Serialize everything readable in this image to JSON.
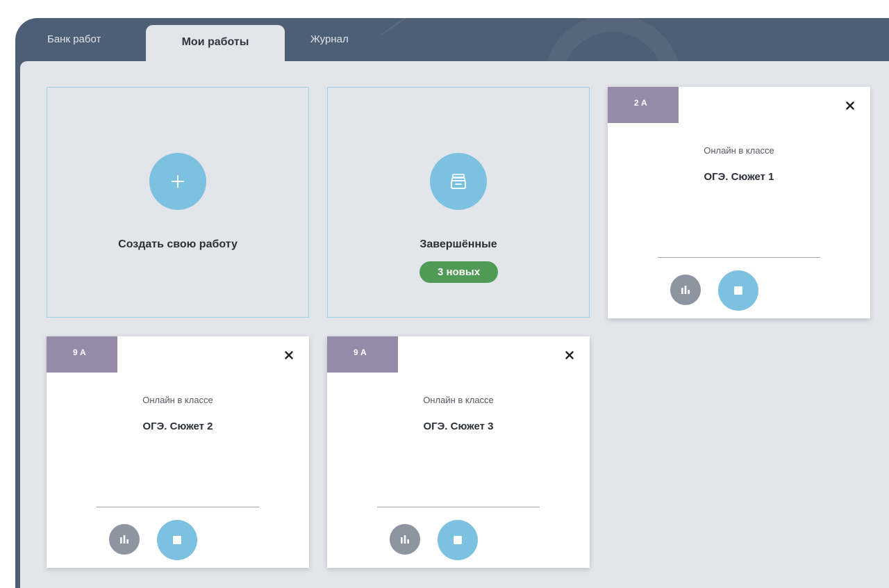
{
  "tabs": {
    "bank": "Банк работ",
    "mine": "Мои работы",
    "journal": "Журнал"
  },
  "tiles": {
    "create": {
      "label": "Создать свою работу",
      "icon": "plus-icon"
    },
    "completed": {
      "label": "Завершённые",
      "badge": "3 новых",
      "icon": "archive-box-icon"
    }
  },
  "cards": [
    {
      "class_name": "2 А",
      "mode": "Онлайн в классе",
      "title": "ОГЭ. Сюжет 1"
    },
    {
      "class_name": "9 А",
      "mode": "Онлайн в классе",
      "title": "ОГЭ. Сюжет 2"
    },
    {
      "class_name": "9 А",
      "mode": "Онлайн в классе",
      "title": "ОГЭ. Сюжет 3"
    }
  ],
  "colors": {
    "header": "#4e5e74",
    "accent": "#7cc1e0",
    "class_tag": "#958aa7",
    "badge": "#4f9a55",
    "stats_button": "#8d95a1"
  }
}
